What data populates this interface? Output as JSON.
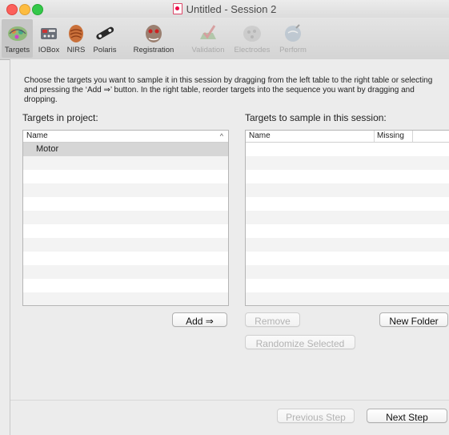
{
  "window": {
    "title": "Untitled - Session 2"
  },
  "toolbar": {
    "items": [
      {
        "label": "Targets",
        "icon": "targets-icon",
        "enabled": true,
        "selected": true
      },
      {
        "label": "IOBox",
        "icon": "iobox-icon",
        "enabled": true,
        "selected": false
      },
      {
        "label": "NIRS",
        "icon": "nirs-icon",
        "enabled": true,
        "selected": false
      },
      {
        "label": "Polaris",
        "icon": "polaris-icon",
        "enabled": true,
        "selected": false
      },
      {
        "label": "Registration",
        "icon": "registration-icon",
        "enabled": true,
        "selected": false
      },
      {
        "label": "Validation",
        "icon": "validation-icon",
        "enabled": false,
        "selected": false
      },
      {
        "label": "Electrodes",
        "icon": "electrodes-icon",
        "enabled": false,
        "selected": false
      },
      {
        "label": "Perform",
        "icon": "perform-icon",
        "enabled": false,
        "selected": false
      }
    ]
  },
  "instructions": "Choose the targets you want to sample it in this session by dragging from the left table to the right table or selecting and pressing the ‘Add ⇒’ button. In the right table, reorder targets into the sequence you want by dragging and dropping.",
  "left_panel": {
    "heading": "Targets in project:",
    "column_name": "Name",
    "sort_indicator": "^",
    "rows": [
      "Motor"
    ],
    "add_button": "Add ⇒"
  },
  "right_panel": {
    "heading": "Targets to sample in this session:",
    "columns": [
      "Name",
      "Missing"
    ],
    "rows": [],
    "remove_button": "Remove",
    "new_folder_button": "New Folder",
    "randomize_button": "Randomize Selected"
  },
  "footer": {
    "previous_button": "Previous Step",
    "next_button": "Next Step"
  }
}
